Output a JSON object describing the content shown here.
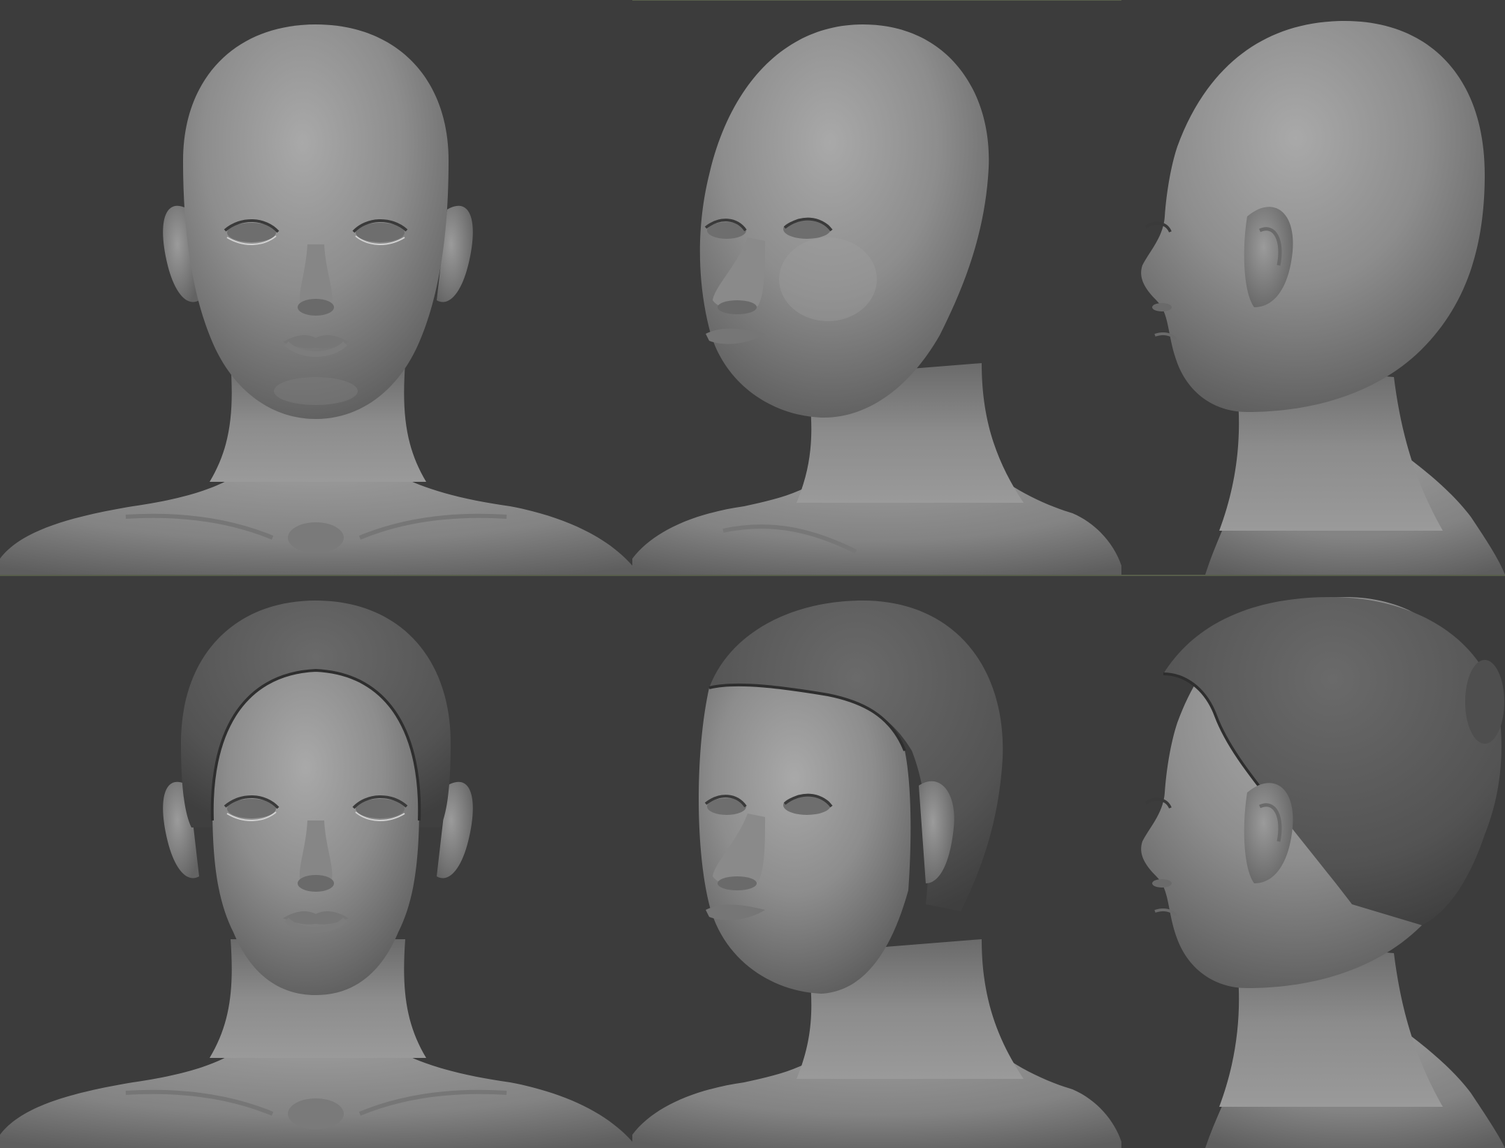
{
  "sheet": {
    "background_color": "#3c3c3c",
    "divider_color": "#575e4b",
    "material_color": "#8c8c8c",
    "hair_color": "#5a5a5a"
  },
  "views": [
    {
      "row": "bald",
      "angle": "front"
    },
    {
      "row": "bald",
      "angle": "three-quarter"
    },
    {
      "row": "bald",
      "angle": "profile"
    },
    {
      "row": "hair",
      "angle": "front"
    },
    {
      "row": "hair",
      "angle": "three-quarter"
    },
    {
      "row": "hair",
      "angle": "profile"
    }
  ]
}
